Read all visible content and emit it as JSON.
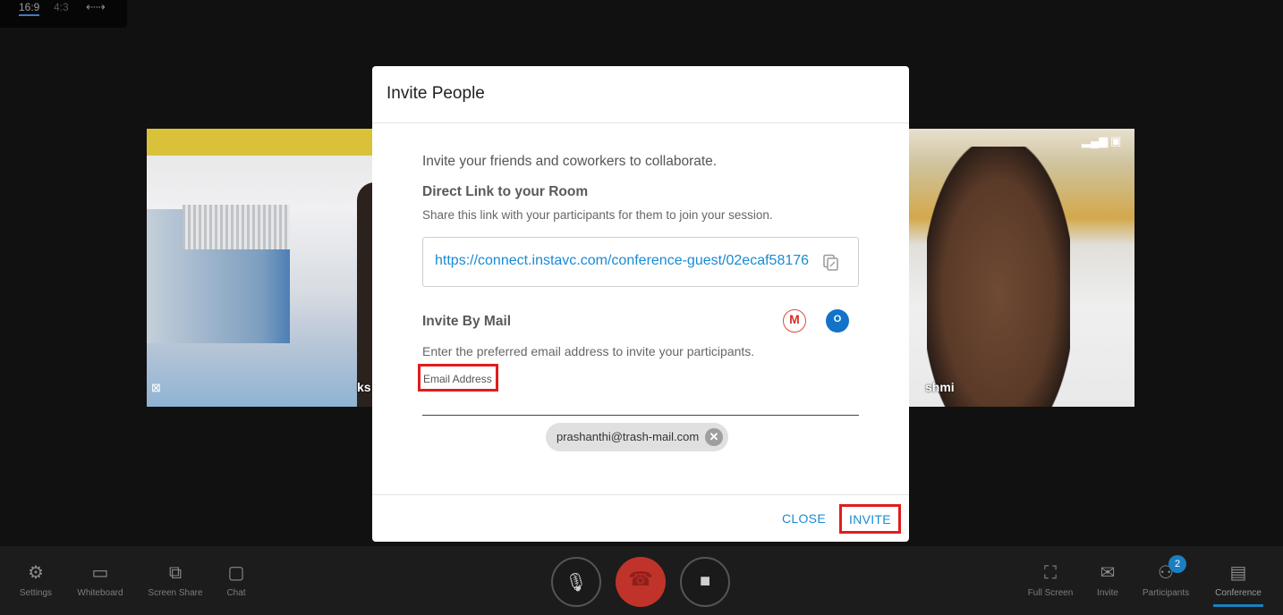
{
  "aspect": {
    "ratio_16_9": "16:9",
    "ratio_4_3": "4:3",
    "arrows": "⇠⇢"
  },
  "tiles": [
    {
      "name": "ks"
    },
    {
      "name": "shmi"
    }
  ],
  "modal": {
    "title": "Invite People",
    "intro": "Invite your friends and coworkers to collaborate.",
    "direct_link": {
      "title": "Direct Link to your Room",
      "subtitle": "Share this link with your participants for them to join your session.",
      "url": "https://connect.instavc.com/conference-guest/02ecaf58176",
      "copy_icon": "copy-icon"
    },
    "invite_mail": {
      "title": "Invite By Mail",
      "subtitle": "Enter the preferred email address to invite your participants.",
      "email_label": "Email Address",
      "email_value": "",
      "gmail_glyph": "M",
      "outlook_glyph": "O",
      "chips": [
        {
          "email": "prashanthi@trash-mail.com"
        }
      ]
    },
    "footer": {
      "close_label": "CLOSE",
      "invite_label": "INVITE"
    }
  },
  "toolbar": {
    "left": [
      {
        "label": "Settings",
        "icon": "gear-icon"
      },
      {
        "label": "Whiteboard",
        "icon": "whiteboard-icon"
      },
      {
        "label": "Screen Share",
        "icon": "screen-share-icon"
      },
      {
        "label": "Chat",
        "icon": "chat-icon"
      }
    ],
    "right": [
      {
        "label": "Full Screen",
        "icon": "fullscreen-icon"
      },
      {
        "label": "Invite",
        "icon": "invite-icon"
      },
      {
        "label": "Participants",
        "icon": "participants-icon"
      },
      {
        "label": "Conference",
        "icon": "conference-icon"
      }
    ],
    "participants_count": "2"
  },
  "colors": {
    "accent": "#1a8ad4",
    "hangup": "#c0332b",
    "highlight": "#e01d1d"
  }
}
